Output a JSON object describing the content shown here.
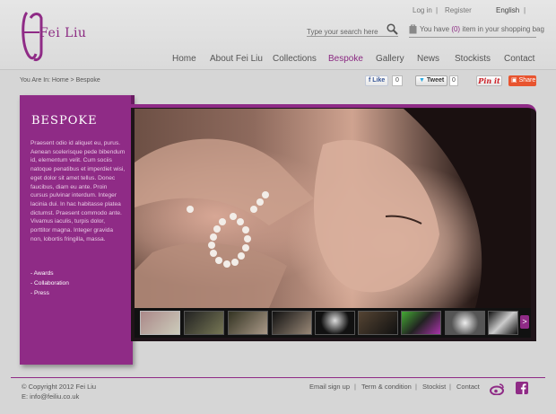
{
  "brand": {
    "name": "Fei Liu",
    "accent": "#8f2b86"
  },
  "toplinks": {
    "login": "Log in",
    "separator": "|",
    "register": "Register",
    "language": "English"
  },
  "search": {
    "placeholder": "Type your search here",
    "icon": "search-icon"
  },
  "cart": {
    "prefix": "You have",
    "count": "(0)",
    "suffix": "item in your shopping bag",
    "icon": "bag-icon"
  },
  "nav": {
    "items": [
      {
        "label": "Home"
      },
      {
        "label": "About Fei Liu"
      },
      {
        "label": "Collections"
      },
      {
        "label": "Bespoke",
        "active": true
      },
      {
        "label": "Gallery"
      },
      {
        "label": "News"
      },
      {
        "label": "Stockists"
      },
      {
        "label": "Contact"
      }
    ]
  },
  "breadcrumb": {
    "text": "You Are In: Home  >  Bespoke"
  },
  "social": {
    "like_label": "Like",
    "like_count": "0",
    "tweet_label": "Tweet",
    "tweet_count": "0",
    "pin_label": "Pin it",
    "share_label": "Share"
  },
  "sidebar": {
    "title": "BESPOKE",
    "body": "Praesent odio id aliquet eu, purus. Aenean scelerisque pede bibendum id, elementum velit. Cum sociis natoque penatibus et imperdiet wisi, eget dolor sit amet tellus. Donec faucibus, diam eu ante. Proin cursus pulvinar interdum. Integer lacinia dui. In hac habitasse platea dictumst. Praesent commodo ante. Vivamus iaculis, turpis dolor, porttitor magna. Integer gravida non, lobortis fringilla, massa.",
    "links": [
      "- Awards",
      "- Collaboration",
      "- Press"
    ]
  },
  "gallery": {
    "thumb_count": 9,
    "next_label": ">"
  },
  "footer": {
    "copyright": "© Copyright 2012 Fei Liu",
    "email": "E: info@feiliu.co.uk",
    "links": [
      "Email sign up",
      "Term & condition",
      "Stockist",
      "Contact"
    ],
    "separator": "|"
  }
}
